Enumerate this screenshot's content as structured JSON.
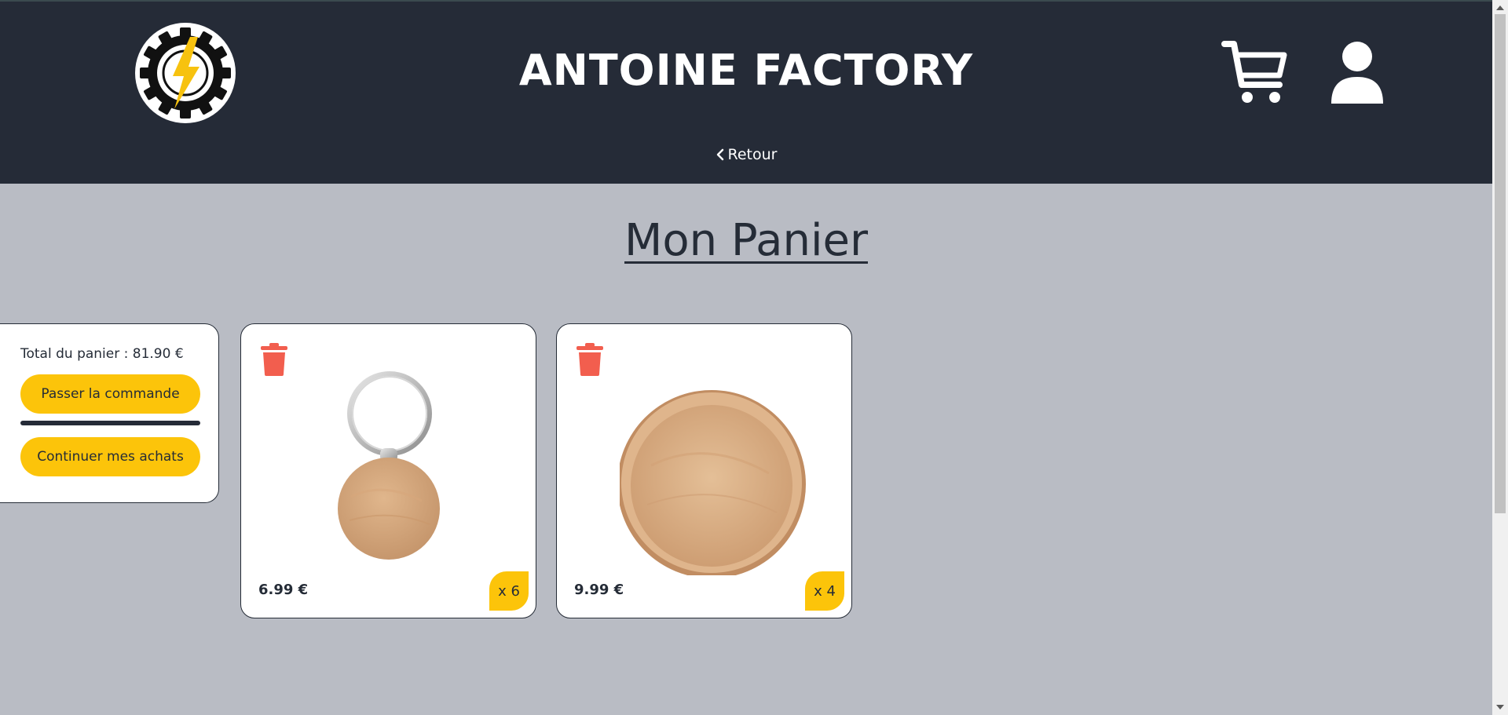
{
  "header": {
    "site_title": "ANTOINE FACTORY",
    "back_label": "Retour",
    "logo_icon": "gear-lightning-logo",
    "cart_icon": "shopping-cart-icon",
    "user_icon": "user-icon"
  },
  "main": {
    "page_title": "Mon Panier"
  },
  "summary": {
    "total_label": "Total du panier : 81.90 €",
    "order_button": "Passer la commande",
    "continue_button": "Continuer mes achats"
  },
  "items": [
    {
      "name": "wooden-keychain",
      "price": "6.99 €",
      "quantity": "x 6"
    },
    {
      "name": "wooden-coaster",
      "price": "9.99 €",
      "quantity": "x 4"
    }
  ],
  "colors": {
    "header_bg": "#252b37",
    "page_bg": "#b9bcc4",
    "accent_yellow": "#fcc40a",
    "trash_red": "#f25e4e"
  }
}
